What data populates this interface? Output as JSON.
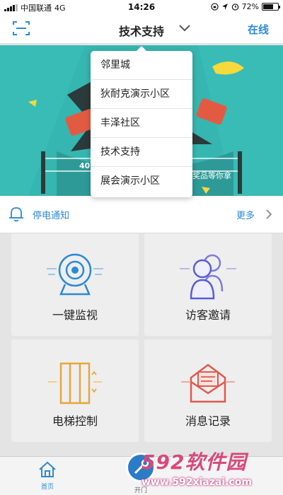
{
  "status_bar": {
    "carrier": "中国联通",
    "network": "4G",
    "time": "14:26",
    "battery": "72%",
    "battery_level": 0.72
  },
  "nav": {
    "title": "技术支持",
    "right_label": "在线"
  },
  "banner": {
    "text_left": "40",
    "text_right": "奖品等你拿"
  },
  "notice": {
    "label": "停电通知",
    "more": "更多"
  },
  "tiles": [
    {
      "label": "一键监视",
      "icon": "camera-icon"
    },
    {
      "label": "访客邀请",
      "icon": "visitors-icon"
    },
    {
      "label": "电梯控制",
      "icon": "elevator-icon"
    },
    {
      "label": "消息记录",
      "icon": "mail-icon"
    }
  ],
  "tabbar": {
    "home_label": "首页",
    "center_label": "开门"
  },
  "dropdown": {
    "items": [
      "邻里城",
      "狄耐克演示小区",
      "丰泽社区",
      "技术支持",
      "展会演示小区"
    ]
  },
  "watermark": {
    "brand": "592软件园",
    "url": "www.592xiazai.com"
  },
  "colors": {
    "accent": "#2b8ad4",
    "banner": "#36b6b0",
    "watermark": "#d64a7a"
  }
}
